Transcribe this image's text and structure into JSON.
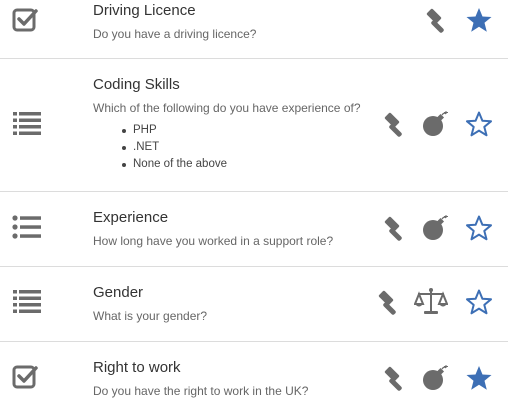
{
  "colors": {
    "icon_gray": "#6b6b6b",
    "star_blue": "#3d6fb5",
    "divider": "#dcdcdc"
  },
  "questions": [
    {
      "type_icon": "checkbox-icon",
      "title": "Driving Licence",
      "subtitle": "Do you have a driving licence?",
      "options": [],
      "actions": [
        "gavel-icon",
        "star-filled-icon"
      ]
    },
    {
      "type_icon": "list-icon",
      "title": "Coding Skills",
      "subtitle": "Which of the following do you have experience of?",
      "options": [
        "PHP",
        ".NET",
        "None of the above"
      ],
      "actions": [
        "gavel-icon",
        "bomb-icon",
        "star-outline-icon"
      ]
    },
    {
      "type_icon": "list-bullets-icon",
      "title": "Experience",
      "subtitle": "How long have you worked in a support role?",
      "options": [],
      "actions": [
        "gavel-icon",
        "bomb-icon",
        "star-outline-icon"
      ]
    },
    {
      "type_icon": "list-icon",
      "title": "Gender",
      "subtitle": "What is your gender?",
      "options": [],
      "actions": [
        "gavel-icon",
        "scales-icon",
        "star-outline-icon"
      ]
    },
    {
      "type_icon": "checkbox-icon",
      "title": "Right to work",
      "subtitle": "Do you have the right to work in the UK?",
      "options": [],
      "actions": [
        "gavel-icon",
        "bomb-icon",
        "star-filled-icon"
      ]
    }
  ]
}
